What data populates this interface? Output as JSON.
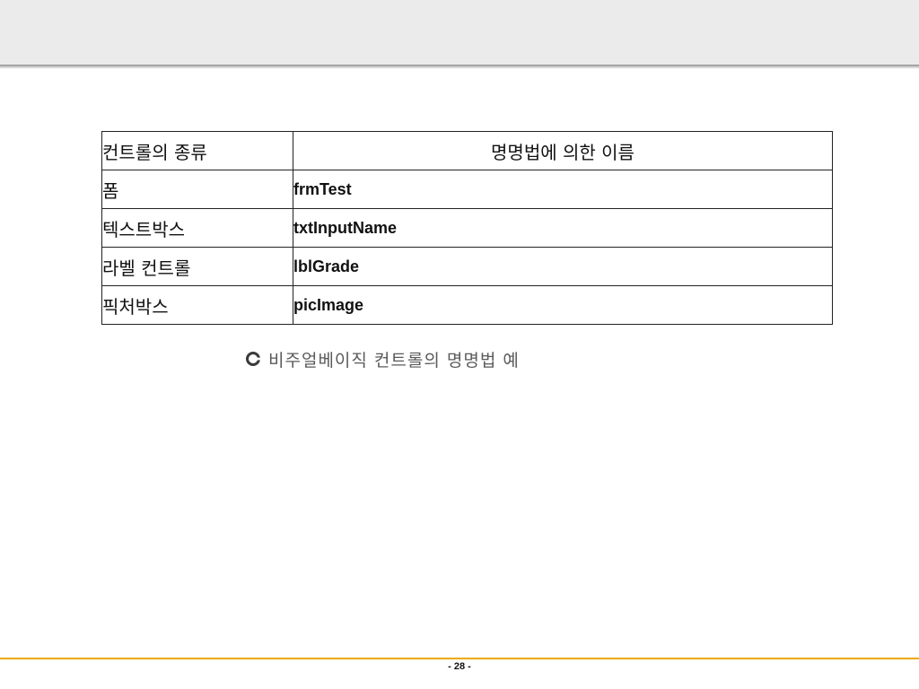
{
  "table": {
    "headers": [
      "컨트롤의 종류",
      "명명법에 의한 이름"
    ],
    "rows": [
      [
        "폼",
        "frmTest"
      ],
      [
        "텍스트박스",
        "txtInputName"
      ],
      [
        "라벨 컨트롤",
        "lblGrade"
      ],
      [
        "픽처박스",
        "picImage"
      ]
    ]
  },
  "caption": {
    "icon": "c-bullet-icon",
    "text": "비주얼베이직 컨트롤의 명명법 예"
  },
  "footer": {
    "page_label": "- 28 -",
    "line_color": "#f0a800"
  }
}
